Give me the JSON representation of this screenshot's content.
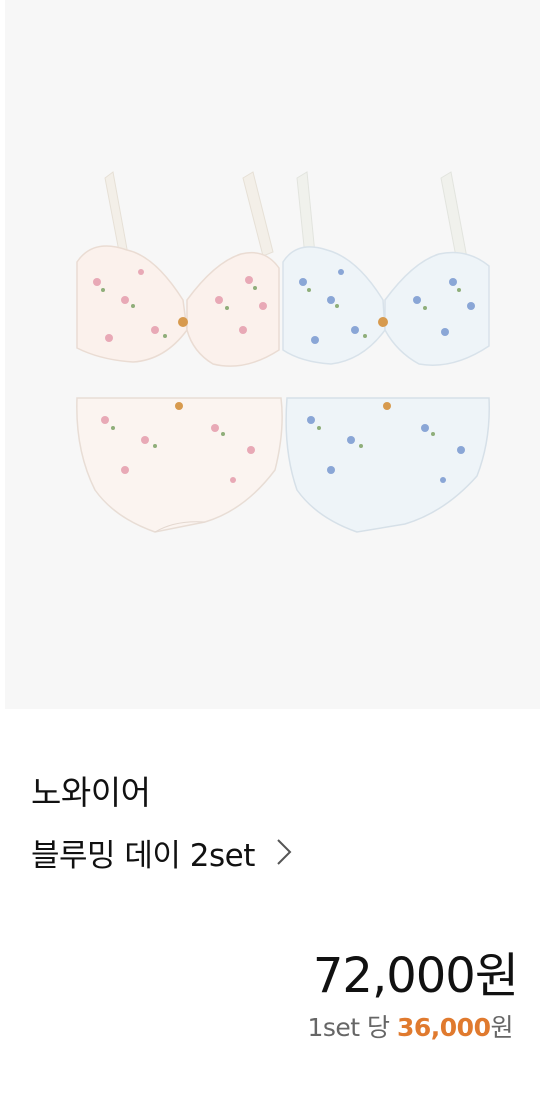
{
  "product": {
    "brand": "노와이어",
    "name": "블루밍 데이 2set",
    "price": "72,000원",
    "per_set": {
      "prefix": "1set 당",
      "value": "36,000",
      "suffix": "원"
    }
  },
  "colors": {
    "background": "#ffffff",
    "image_background": "#f7f7f7",
    "accent": "#e07a2e",
    "set_pink": "#fbf3ef",
    "set_blue": "#eef4f8"
  },
  "icons": {
    "chevron": "chevron-right-icon"
  }
}
